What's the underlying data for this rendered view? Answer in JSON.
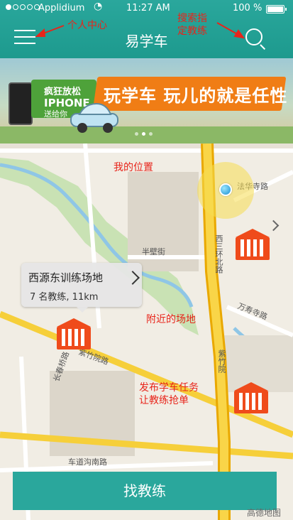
{
  "status_bar": {
    "carrier": "Applidium",
    "time": "11:27 AM",
    "battery": "100 %"
  },
  "header": {
    "title": "易学车"
  },
  "annotations": {
    "menu": "个人中心",
    "search_line1": "搜索指",
    "search_line2": "定教练",
    "my_location": "我的位置",
    "nearby_venue": "附近的场地",
    "post_task_line1": "发布学车任务",
    "post_task_line2": "让教练抢单"
  },
  "banner": {
    "promo_line1": "疯狂放松",
    "promo_line2": "IPHONE",
    "promo_line3": "送给你",
    "headline": "玩学车 玩儿的就是任性",
    "slides": 3,
    "active_slide": 1
  },
  "map": {
    "street_labels": [
      "半壁街",
      "西三环北路",
      "法华寺路",
      "万寿寺路",
      "紫竹院路",
      "长春桥路",
      "车道沟南路",
      "紫竹院"
    ],
    "attribution": "高德地图"
  },
  "venue_popup": {
    "title": "西源东训练场地",
    "subtitle": "7 名教练, 11km"
  },
  "cta": {
    "label": "找教练"
  },
  "colors": {
    "primary_teal": "#2aa79c",
    "venue_marker": "#ef4b1b",
    "annotation_red": "#e8241a"
  },
  "icons": {
    "menu": "hamburger-menu-icon",
    "search": "search-icon",
    "location": "current-location-dot",
    "venue": "training-venue-marker"
  }
}
